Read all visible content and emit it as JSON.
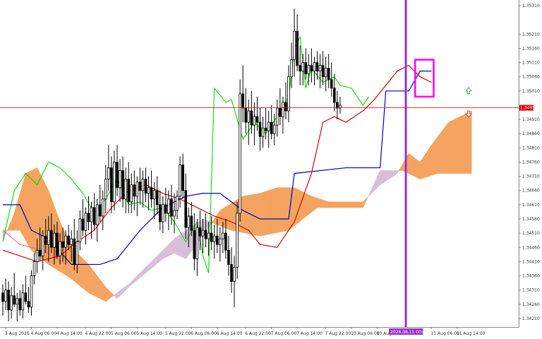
{
  "chart_data": {
    "type": "candlestick",
    "symbol_current_price": "1.34951",
    "current_price_value": 1.34951,
    "y_axis_labels": [
      "1.35310",
      "1.35210",
      "1.35160",
      "1.35110",
      "1.35060",
      "1.35010",
      "1.34951",
      "1.34910",
      "1.34860",
      "1.34810",
      "1.34760",
      "1.34710",
      "1.34660",
      "1.34610",
      "1.34560",
      "1.34510",
      "1.34460",
      "1.34410",
      "1.34360",
      "1.34310",
      "1.34260",
      "1.34210"
    ],
    "y_axis_values": [
      1.3531,
      1.3521,
      1.3516,
      1.3511,
      1.3506,
      1.3501,
      1.34951,
      1.3491,
      1.3486,
      1.3481,
      1.3476,
      1.3471,
      1.3466,
      1.3461,
      1.3456,
      1.3451,
      1.3446,
      1.3441,
      1.3436,
      1.3431,
      1.3426,
      1.3421
    ],
    "ylim": [
      1.3418,
      1.3533
    ],
    "x_axis_labels": [
      "3 Aug 2026",
      "4 Aug 06:00",
      "4 Aug 14:00",
      "4 Aug 22:00",
      "5 Aug 06:00",
      "5 Aug 14:00",
      "5 Aug 22:00",
      "6 Aug 06:00",
      "6 Aug 14:00",
      "6 Aug 22:00",
      "7 Aug 06:00",
      "7 Aug 14:00",
      "7 Aug 22:00",
      "10 Aug 06:00",
      "10 Aug 14:00",
      "2026.08.11 00:00",
      "11 Aug 06:00",
      "11 Aug 14:00"
    ],
    "x_axis_label_slots": [
      1,
      10,
      19,
      29,
      38,
      47,
      57,
      66,
      75,
      85,
      94,
      103,
      113,
      122,
      131,
      141,
      150,
      159
    ],
    "highlighted_time": "2026.08.11 00:00",
    "candles": [
      [
        1.343,
        1.3433,
        1.3422,
        1.3427
      ],
      [
        1.3427,
        1.3435,
        1.3424,
        1.3431
      ],
      [
        1.3431,
        1.3434,
        1.342,
        1.3424
      ],
      [
        1.3424,
        1.3432,
        1.3421,
        1.3429
      ],
      [
        1.3429,
        1.3437,
        1.3425,
        1.3426
      ],
      [
        1.3426,
        1.343,
        1.342,
        1.3428
      ],
      [
        1.3428,
        1.3431,
        1.3422,
        1.3424
      ],
      [
        1.3424,
        1.3433,
        1.3421,
        1.343
      ],
      [
        1.343,
        1.3436,
        1.3426,
        1.3427
      ],
      [
        1.3427,
        1.3432,
        1.3423,
        1.3425
      ],
      [
        1.3425,
        1.3438,
        1.3422,
        1.3436
      ],
      [
        1.3436,
        1.3444,
        1.3433,
        1.3441
      ],
      [
        1.3441,
        1.3449,
        1.3437,
        1.3445
      ],
      [
        1.3445,
        1.3453,
        1.3441,
        1.3443
      ],
      [
        1.3443,
        1.3452,
        1.3438,
        1.345
      ],
      [
        1.345,
        1.3456,
        1.3444,
        1.3447
      ],
      [
        1.3447,
        1.3457,
        1.3441,
        1.3452
      ],
      [
        1.3452,
        1.3458,
        1.3444,
        1.3446
      ],
      [
        1.3446,
        1.3454,
        1.344,
        1.3451
      ],
      [
        1.3451,
        1.3455,
        1.3442,
        1.3443
      ],
      [
        1.3443,
        1.3451,
        1.344,
        1.3448
      ],
      [
        1.3448,
        1.3453,
        1.3441,
        1.3446
      ],
      [
        1.3446,
        1.3452,
        1.344,
        1.345
      ],
      [
        1.345,
        1.3454,
        1.3445,
        1.3447
      ],
      [
        1.3447,
        1.3452,
        1.3441,
        1.3449
      ],
      [
        1.3449,
        1.3456,
        1.3438,
        1.344
      ],
      [
        1.344,
        1.3452,
        1.3437,
        1.3448
      ],
      [
        1.3448,
        1.3459,
        1.3445,
        1.3456
      ],
      [
        1.3456,
        1.3463,
        1.345,
        1.3452
      ],
      [
        1.3452,
        1.346,
        1.3447,
        1.3458
      ],
      [
        1.3458,
        1.3464,
        1.3452,
        1.3455
      ],
      [
        1.3455,
        1.3462,
        1.3449,
        1.346
      ],
      [
        1.346,
        1.3465,
        1.3452,
        1.3454
      ],
      [
        1.3454,
        1.3463,
        1.3448,
        1.3461
      ],
      [
        1.3461,
        1.3468,
        1.3455,
        1.3457
      ],
      [
        1.3457,
        1.3466,
        1.3452,
        1.3463
      ],
      [
        1.3463,
        1.3475,
        1.3458,
        1.347
      ],
      [
        1.347,
        1.3482,
        1.3466,
        1.3474
      ],
      [
        1.3474,
        1.3478,
        1.3458,
        1.3462
      ],
      [
        1.3462,
        1.348,
        1.3459,
        1.3476
      ],
      [
        1.3476,
        1.3482,
        1.3464,
        1.3467
      ],
      [
        1.3467,
        1.3477,
        1.3462,
        1.3473
      ],
      [
        1.3473,
        1.3478,
        1.346,
        1.3463
      ],
      [
        1.3463,
        1.3474,
        1.3458,
        1.347
      ],
      [
        1.347,
        1.3476,
        1.3458,
        1.3462
      ],
      [
        1.3462,
        1.3472,
        1.3458,
        1.3468
      ],
      [
        1.3468,
        1.3473,
        1.3459,
        1.3464
      ],
      [
        1.3464,
        1.3471,
        1.3457,
        1.3469
      ],
      [
        1.3469,
        1.3474,
        1.3461,
        1.3466
      ],
      [
        1.3466,
        1.3473,
        1.346,
        1.347
      ],
      [
        1.347,
        1.3474,
        1.3462,
        1.3465
      ],
      [
        1.3465,
        1.3471,
        1.3459,
        1.3467
      ],
      [
        1.3467,
        1.3473,
        1.346,
        1.3463
      ],
      [
        1.3463,
        1.3469,
        1.3456,
        1.3466
      ],
      [
        1.3466,
        1.3471,
        1.3458,
        1.3461
      ],
      [
        1.3461,
        1.3466,
        1.3452,
        1.3455
      ],
      [
        1.3455,
        1.3464,
        1.3451,
        1.3461
      ],
      [
        1.3461,
        1.3467,
        1.3455,
        1.3458
      ],
      [
        1.3458,
        1.3466,
        1.3452,
        1.3463
      ],
      [
        1.3463,
        1.3468,
        1.3454,
        1.3457
      ],
      [
        1.3457,
        1.3465,
        1.3451,
        1.3459
      ],
      [
        1.3459,
        1.3466,
        1.3456,
        1.3464
      ],
      [
        1.3464,
        1.3478,
        1.346,
        1.3475
      ],
      [
        1.3475,
        1.3479,
        1.3463,
        1.3466
      ],
      [
        1.3466,
        1.3472,
        1.3449,
        1.3453
      ],
      [
        1.3453,
        1.346,
        1.3446,
        1.3457
      ],
      [
        1.3457,
        1.3462,
        1.345,
        1.3452
      ],
      [
        1.3452,
        1.3458,
        1.3438,
        1.3442
      ],
      [
        1.3442,
        1.3456,
        1.3436,
        1.3453
      ],
      [
        1.3453,
        1.3459,
        1.3445,
        1.345
      ],
      [
        1.345,
        1.3456,
        1.3444,
        1.3452
      ],
      [
        1.3452,
        1.3458,
        1.3446,
        1.3449
      ],
      [
        1.3449,
        1.3455,
        1.3443,
        1.3451
      ],
      [
        1.3451,
        1.3457,
        1.3445,
        1.3448
      ],
      [
        1.3448,
        1.3454,
        1.3442,
        1.345
      ],
      [
        1.345,
        1.3456,
        1.3444,
        1.3447
      ],
      [
        1.3447,
        1.3453,
        1.3441,
        1.3449
      ],
      [
        1.3449,
        1.3455,
        1.3444,
        1.3451
      ],
      [
        1.3451,
        1.3456,
        1.3442,
        1.3445
      ],
      [
        1.3445,
        1.345,
        1.3436,
        1.344
      ],
      [
        1.344,
        1.3446,
        1.343,
        1.3434
      ],
      [
        1.3434,
        1.3443,
        1.3425,
        1.3439
      ],
      [
        1.3439,
        1.3462,
        1.3435,
        1.3458
      ],
      [
        1.3458,
        1.3505,
        1.3455,
        1.35
      ],
      [
        1.35,
        1.351,
        1.349,
        1.3495
      ],
      [
        1.3495,
        1.3502,
        1.3486,
        1.349
      ],
      [
        1.349,
        1.3498,
        1.3482,
        1.3494
      ],
      [
        1.3494,
        1.3501,
        1.3486,
        1.3489
      ],
      [
        1.3489,
        1.3497,
        1.3482,
        1.3492
      ],
      [
        1.3492,
        1.3499,
        1.3487,
        1.349
      ],
      [
        1.349,
        1.3495,
        1.348,
        1.3485
      ],
      [
        1.3485,
        1.3492,
        1.3481,
        1.3488
      ],
      [
        1.3488,
        1.3495,
        1.3484,
        1.3487
      ],
      [
        1.3487,
        1.3494,
        1.3481,
        1.349
      ],
      [
        1.349,
        1.3496,
        1.3484,
        1.3486
      ],
      [
        1.3486,
        1.3493,
        1.3482,
        1.3489
      ],
      [
        1.3489,
        1.3498,
        1.3485,
        1.3495
      ],
      [
        1.3495,
        1.3502,
        1.3489,
        1.3492
      ],
      [
        1.3492,
        1.3499,
        1.3486,
        1.3497
      ],
      [
        1.3497,
        1.3504,
        1.3491,
        1.3494
      ],
      [
        1.3494,
        1.351,
        1.349,
        1.3506
      ],
      [
        1.3506,
        1.3518,
        1.3502,
        1.3512
      ],
      [
        1.3512,
        1.353,
        1.3506,
        1.3522
      ],
      [
        1.3522,
        1.3528,
        1.3508,
        1.351
      ],
      [
        1.351,
        1.3517,
        1.3503,
        1.3508
      ],
      [
        1.3508,
        1.3514,
        1.3503,
        1.3511
      ],
      [
        1.3511,
        1.3516,
        1.3505,
        1.3507
      ],
      [
        1.3507,
        1.3514,
        1.3503,
        1.351
      ],
      [
        1.351,
        1.3516,
        1.3504,
        1.3508
      ],
      [
        1.3508,
        1.3513,
        1.3503,
        1.3511
      ],
      [
        1.3511,
        1.3515,
        1.3505,
        1.3508
      ],
      [
        1.3508,
        1.3514,
        1.3502,
        1.351
      ],
      [
        1.351,
        1.3515,
        1.3503,
        1.3506
      ],
      [
        1.3506,
        1.3513,
        1.3501,
        1.3509
      ],
      [
        1.3509,
        1.3514,
        1.3502,
        1.3505
      ],
      [
        1.3505,
        1.3511,
        1.3499,
        1.3502
      ],
      [
        1.3502,
        1.3507,
        1.3494,
        1.3497
      ],
      [
        1.3497,
        1.3501,
        1.3491,
        1.3495
      ],
      [
        1.3495,
        1.3499,
        1.3493,
        1.3496
      ]
    ],
    "indicators": {
      "tenkan_color": "#dd0000",
      "kijun_color": "#0000cc",
      "chikou_color": "#00dd00",
      "kumo_bull_color": "#f4a460",
      "kumo_bear_color": "#d8bfd8",
      "current_price_line_color": "#dd0000",
      "time_marker_color": "#9932cc",
      "highlight_box_color": "#ff00ff",
      "kijun_points": [
        [
          0,
          1.3461
        ],
        [
          6,
          1.3461
        ],
        [
          10,
          1.3452
        ],
        [
          16,
          1.3449
        ],
        [
          24,
          1.344
        ],
        [
          34,
          1.344
        ],
        [
          40,
          1.3442
        ],
        [
          48,
          1.3452
        ],
        [
          56,
          1.346
        ],
        [
          64,
          1.3464
        ],
        [
          70,
          1.3465
        ],
        [
          76,
          1.3465
        ],
        [
          84,
          1.3459
        ],
        [
          90,
          1.3456
        ],
        [
          100,
          1.3456
        ],
        [
          102,
          1.3472
        ],
        [
          120,
          1.3474
        ],
        [
          132,
          1.3474
        ],
        [
          134,
          1.3501
        ],
        [
          142,
          1.3501
        ],
        [
          146,
          1.3508
        ],
        [
          150,
          1.3508
        ]
      ],
      "ghost_points": [
        [
          0,
          1.3452
        ],
        [
          6,
          1.3447
        ],
        [
          14,
          1.3445
        ],
        [
          22,
          1.344
        ]
      ],
      "tenkan_points": [
        [
          0,
          1.3445
        ],
        [
          6,
          1.3443
        ],
        [
          12,
          1.3441
        ],
        [
          20,
          1.3443
        ],
        [
          26,
          1.3448
        ],
        [
          32,
          1.3452
        ],
        [
          38,
          1.346
        ],
        [
          44,
          1.3466
        ],
        [
          50,
          1.3468
        ],
        [
          56,
          1.3465
        ],
        [
          62,
          1.3463
        ],
        [
          68,
          1.346
        ],
        [
          74,
          1.3457
        ],
        [
          80,
          1.3455
        ],
        [
          86,
          1.3452
        ],
        [
          90,
          1.3447
        ],
        [
          96,
          1.3446
        ],
        [
          102,
          1.3455
        ],
        [
          108,
          1.3472
        ],
        [
          112,
          1.349
        ],
        [
          116,
          1.3492
        ],
        [
          120,
          1.349
        ],
        [
          126,
          1.3494
        ],
        [
          130,
          1.3498
        ],
        [
          134,
          1.3503
        ],
        [
          138,
          1.3508
        ],
        [
          142,
          1.351
        ],
        [
          146,
          1.3506
        ],
        [
          150,
          1.3504
        ]
      ],
      "chikou_points": [
        [
          0,
          1.3448
        ],
        [
          4,
          1.3466
        ],
        [
          8,
          1.3472
        ],
        [
          12,
          1.3468
        ],
        [
          16,
          1.3476
        ],
        [
          20,
          1.3474
        ],
        [
          24,
          1.347
        ],
        [
          28,
          1.3465
        ],
        [
          32,
          1.3458
        ],
        [
          36,
          1.3463
        ],
        [
          40,
          1.347
        ],
        [
          44,
          1.3461
        ],
        [
          48,
          1.3462
        ],
        [
          52,
          1.3459
        ],
        [
          56,
          1.346
        ],
        [
          60,
          1.3455
        ],
        [
          64,
          1.3448
        ],
        [
          68,
          1.3455
        ],
        [
          70,
          1.3443
        ],
        [
          72,
          1.3437
        ],
        [
          74,
          1.3502
        ],
        [
          78,
          1.3497
        ],
        [
          80,
          1.3498
        ],
        [
          84,
          1.3484
        ],
        [
          88,
          1.349
        ],
        [
          92,
          1.3486
        ],
        [
          96,
          1.3492
        ],
        [
          100,
          1.3499
        ],
        [
          102,
          1.3516
        ],
        [
          104,
          1.352
        ],
        [
          106,
          1.3502
        ],
        [
          108,
          1.3509
        ],
        [
          112,
          1.3504
        ],
        [
          116,
          1.3506
        ],
        [
          118,
          1.3503
        ],
        [
          122,
          1.3502
        ],
        [
          126,
          1.3496
        ],
        [
          128,
          1.3499
        ]
      ],
      "senkou_a_points": [
        [
          0,
          1.3448
        ],
        [
          4,
          1.3458
        ],
        [
          8,
          1.3472
        ],
        [
          12,
          1.3474
        ],
        [
          16,
          1.3466
        ],
        [
          20,
          1.3455
        ],
        [
          24,
          1.3446
        ],
        [
          30,
          1.344
        ],
        [
          36,
          1.3432
        ],
        [
          40,
          1.3428
        ],
        [
          44,
          1.3432
        ],
        [
          50,
          1.3437
        ],
        [
          56,
          1.3442
        ],
        [
          60,
          1.3444
        ],
        [
          64,
          1.3442
        ],
        [
          70,
          1.345
        ],
        [
          76,
          1.3459
        ],
        [
          84,
          1.3464
        ],
        [
          90,
          1.3465
        ],
        [
          96,
          1.3467
        ],
        [
          102,
          1.3467
        ],
        [
          108,
          1.3464
        ],
        [
          114,
          1.3462
        ],
        [
          120,
          1.3462
        ],
        [
          126,
          1.3462
        ],
        [
          132,
          1.3468
        ],
        [
          138,
          1.3472
        ],
        [
          142,
          1.3479
        ],
        [
          146,
          1.3476
        ],
        [
          150,
          1.3482
        ],
        [
          156,
          1.349
        ],
        [
          164,
          1.3494
        ],
        [
          172,
          1.35
        ],
        [
          180,
          1.3502
        ],
        [
          184,
          1.35
        ]
      ],
      "senkou_b_points": [
        [
          0,
          1.3452
        ],
        [
          6,
          1.3452
        ],
        [
          10,
          1.3445
        ],
        [
          16,
          1.344
        ],
        [
          24,
          1.3435
        ],
        [
          30,
          1.343
        ],
        [
          36,
          1.3427
        ],
        [
          44,
          1.3433
        ],
        [
          52,
          1.3441
        ],
        [
          60,
          1.3449
        ],
        [
          70,
          1.3456
        ],
        [
          80,
          1.3452
        ],
        [
          90,
          1.345
        ],
        [
          100,
          1.3452
        ],
        [
          110,
          1.346
        ],
        [
          120,
          1.346
        ],
        [
          126,
          1.346
        ],
        [
          132,
          1.3473
        ],
        [
          140,
          1.3473
        ],
        [
          146,
          1.347
        ],
        [
          152,
          1.3472
        ],
        [
          158,
          1.3472
        ],
        [
          164,
          1.3472
        ]
      ]
    }
  }
}
